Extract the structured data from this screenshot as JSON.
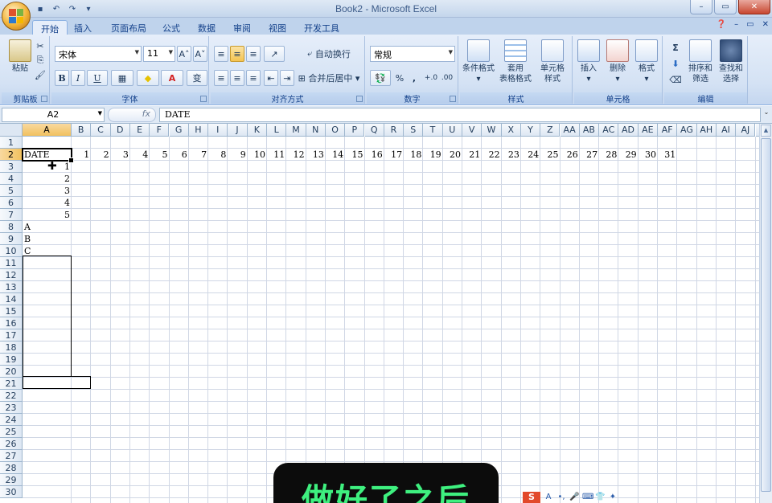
{
  "window": {
    "title": "Book2 - Microsoft Excel"
  },
  "qat": {
    "icons": [
      "save-icon",
      "undo-icon",
      "redo-icon",
      "customize-icon"
    ]
  },
  "window_controls": {
    "ribbon_min": "–",
    "minimize": "–",
    "restore": "▭",
    "close": "✕"
  },
  "tabs": [
    {
      "label": "开始",
      "active": true
    },
    {
      "label": "插入"
    },
    {
      "label": "页面布局"
    },
    {
      "label": "公式"
    },
    {
      "label": "数据"
    },
    {
      "label": "审阅"
    },
    {
      "label": "视图"
    },
    {
      "label": "开发工具"
    }
  ],
  "ribbon": {
    "clipboard": {
      "label": "剪贴板",
      "paste": "粘贴"
    },
    "font": {
      "label": "字体",
      "name": "宋体",
      "size": "11",
      "bold": "B",
      "italic": "I",
      "underline": "U",
      "grow": "A˄",
      "shrink": "A˅",
      "font_color": "A",
      "phonetic": "变"
    },
    "align": {
      "label": "对齐方式",
      "wrap": "自动换行",
      "merge": "合并后居中"
    },
    "number": {
      "label": "数字",
      "format": "常规",
      "percent": "%",
      "comma": ",",
      "inc": "+.0",
      "dec": ".00"
    },
    "styles": {
      "label": "样式",
      "cond": "条件格式",
      "table1": "套用",
      "table2": "表格格式",
      "cell1": "单元格",
      "cell2": "样式"
    },
    "cells": {
      "label": "单元格",
      "insert": "插入",
      "delete": "删除",
      "format": "格式"
    },
    "edit": {
      "label": "编辑",
      "sigma": "Σ",
      "sort1": "排序和",
      "sort2": "筛选",
      "find1": "查找和",
      "find2": "选择"
    }
  },
  "formula_bar": {
    "name_box": "A2",
    "fx": "fx",
    "content": "DATE"
  },
  "columns": [
    "A",
    "B",
    "C",
    "D",
    "E",
    "F",
    "G",
    "H",
    "I",
    "J",
    "K",
    "L",
    "M",
    "N",
    "O",
    "P",
    "Q",
    "R",
    "S",
    "T",
    "U",
    "V",
    "W",
    "X",
    "Y",
    "Z",
    "AA",
    "AB",
    "AC",
    "AD",
    "AE",
    "AF",
    "AG",
    "AH",
    "AI",
    "AJ",
    "A"
  ],
  "rows": [
    "1",
    "2",
    "3",
    "4",
    "5",
    "6",
    "7",
    "8",
    "9",
    "10",
    "11",
    "12",
    "13",
    "14",
    "15",
    "16",
    "17",
    "18",
    "19",
    "20",
    "21",
    "22",
    "23",
    "24",
    "25",
    "26",
    "27",
    "28",
    "29",
    "30"
  ],
  "sheet": {
    "a2": "DATE",
    "row2_values": [
      "1",
      "2",
      "3",
      "4",
      "5",
      "6",
      "7",
      "8",
      "9",
      "10",
      "11",
      "12",
      "13",
      "14",
      "15",
      "16",
      "17",
      "18",
      "19",
      "20",
      "21",
      "22",
      "23",
      "24",
      "25",
      "26",
      "27",
      "28",
      "29",
      "30",
      "31"
    ],
    "a_col_numbers": [
      "1",
      "2",
      "3",
      "4",
      "5"
    ],
    "a_col_letters": [
      "A",
      "B",
      "C"
    ]
  },
  "caption": {
    "text": "做好了之后"
  },
  "ime": {
    "logo": "S",
    "label": "A"
  }
}
